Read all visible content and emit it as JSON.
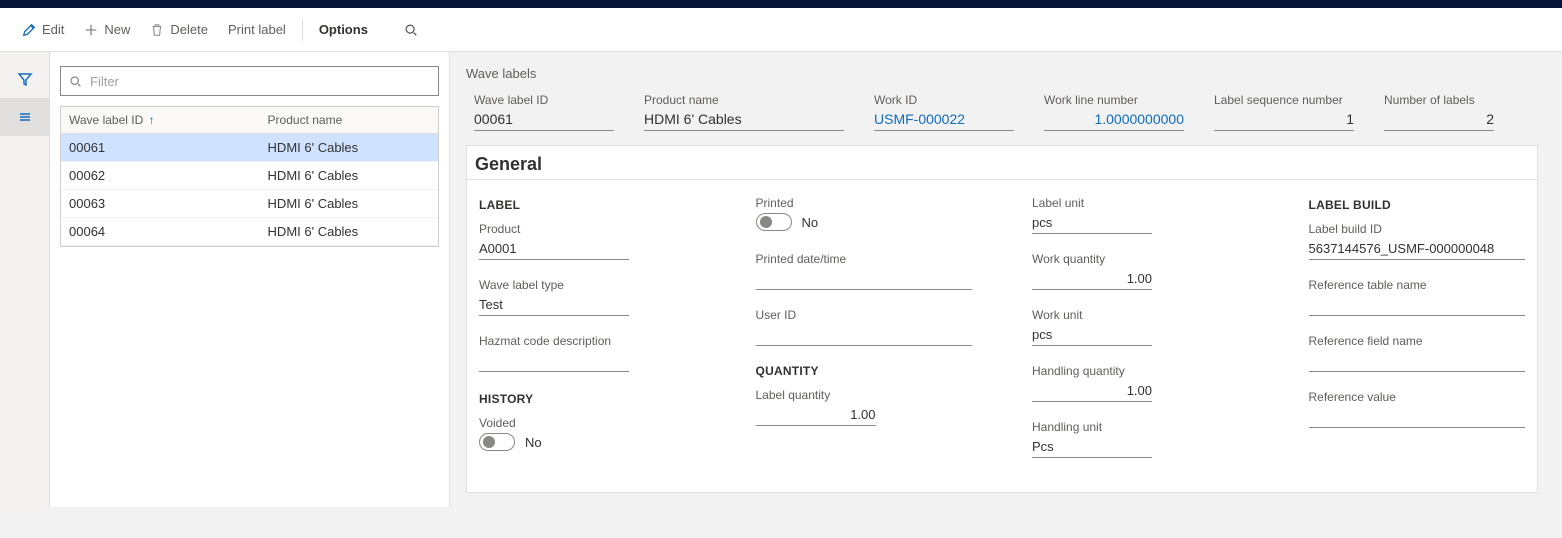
{
  "toolbar": {
    "edit": "Edit",
    "new": "New",
    "delete": "Delete",
    "printLabel": "Print label",
    "options": "Options"
  },
  "filter": {
    "placeholder": "Filter"
  },
  "grid": {
    "col1": "Wave label ID",
    "col2": "Product name",
    "rows": [
      {
        "id": "00061",
        "product": "HDMI 6' Cables"
      },
      {
        "id": "00062",
        "product": "HDMI 6' Cables"
      },
      {
        "id": "00063",
        "product": "HDMI 6' Cables"
      },
      {
        "id": "00064",
        "product": "HDMI 6' Cables"
      }
    ]
  },
  "detail": {
    "title": "Wave labels",
    "header": {
      "waveLabelId": {
        "label": "Wave label ID",
        "value": "00061"
      },
      "productName": {
        "label": "Product name",
        "value": "HDMI 6' Cables"
      },
      "workId": {
        "label": "Work ID",
        "value": "USMF-000022"
      },
      "workLineNumber": {
        "label": "Work line number",
        "value": "1.0000000000"
      },
      "labelSeqNum": {
        "label": "Label sequence number",
        "value": "1"
      },
      "numberOfLabels": {
        "label": "Number of labels",
        "value": "2"
      }
    },
    "generalTitle": "General",
    "groups": {
      "label": {
        "title": "LABEL",
        "product": {
          "label": "Product",
          "value": "A0001"
        },
        "waveLabelType": {
          "label": "Wave label type",
          "value": "Test"
        },
        "hazmat": {
          "label": "Hazmat code description",
          "value": ""
        }
      },
      "history": {
        "title": "HISTORY",
        "voided": {
          "label": "Voided",
          "value": "No"
        }
      },
      "printed": {
        "printed": {
          "label": "Printed",
          "value": "No"
        },
        "printedDateTime": {
          "label": "Printed date/time",
          "value": ""
        },
        "userId": {
          "label": "User ID",
          "value": ""
        }
      },
      "quantity": {
        "title": "QUANTITY",
        "labelQuantity": {
          "label": "Label quantity",
          "value": "1.00"
        }
      },
      "work": {
        "labelUnit": {
          "label": "Label unit",
          "value": "pcs"
        },
        "workQuantity": {
          "label": "Work quantity",
          "value": "1.00"
        },
        "workUnit": {
          "label": "Work unit",
          "value": "pcs"
        },
        "handlingQuantity": {
          "label": "Handling quantity",
          "value": "1.00"
        },
        "handlingUnit": {
          "label": "Handling unit",
          "value": "Pcs"
        }
      },
      "labelBuild": {
        "title": "LABEL BUILD",
        "labelBuildId": {
          "label": "Label build ID",
          "value": "5637144576_USMF-000000048"
        },
        "refTable": {
          "label": "Reference table name",
          "value": ""
        },
        "refField": {
          "label": "Reference field name",
          "value": ""
        },
        "refValue": {
          "label": "Reference value",
          "value": ""
        }
      }
    }
  }
}
